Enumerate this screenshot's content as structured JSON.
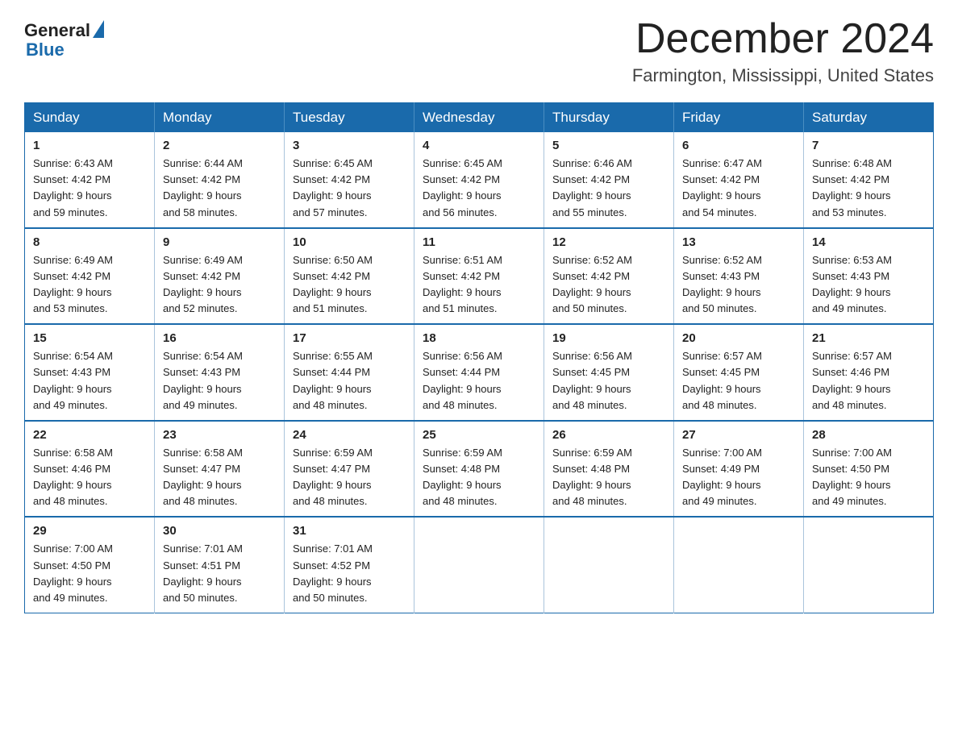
{
  "logo": {
    "general": "General",
    "blue": "Blue"
  },
  "header": {
    "month": "December 2024",
    "location": "Farmington, Mississippi, United States"
  },
  "weekdays": [
    "Sunday",
    "Monday",
    "Tuesday",
    "Wednesday",
    "Thursday",
    "Friday",
    "Saturday"
  ],
  "weeks": [
    [
      {
        "day": 1,
        "info": "Sunrise: 6:43 AM\nSunset: 4:42 PM\nDaylight: 9 hours\nand 59 minutes."
      },
      {
        "day": 2,
        "info": "Sunrise: 6:44 AM\nSunset: 4:42 PM\nDaylight: 9 hours\nand 58 minutes."
      },
      {
        "day": 3,
        "info": "Sunrise: 6:45 AM\nSunset: 4:42 PM\nDaylight: 9 hours\nand 57 minutes."
      },
      {
        "day": 4,
        "info": "Sunrise: 6:45 AM\nSunset: 4:42 PM\nDaylight: 9 hours\nand 56 minutes."
      },
      {
        "day": 5,
        "info": "Sunrise: 6:46 AM\nSunset: 4:42 PM\nDaylight: 9 hours\nand 55 minutes."
      },
      {
        "day": 6,
        "info": "Sunrise: 6:47 AM\nSunset: 4:42 PM\nDaylight: 9 hours\nand 54 minutes."
      },
      {
        "day": 7,
        "info": "Sunrise: 6:48 AM\nSunset: 4:42 PM\nDaylight: 9 hours\nand 53 minutes."
      }
    ],
    [
      {
        "day": 8,
        "info": "Sunrise: 6:49 AM\nSunset: 4:42 PM\nDaylight: 9 hours\nand 53 minutes."
      },
      {
        "day": 9,
        "info": "Sunrise: 6:49 AM\nSunset: 4:42 PM\nDaylight: 9 hours\nand 52 minutes."
      },
      {
        "day": 10,
        "info": "Sunrise: 6:50 AM\nSunset: 4:42 PM\nDaylight: 9 hours\nand 51 minutes."
      },
      {
        "day": 11,
        "info": "Sunrise: 6:51 AM\nSunset: 4:42 PM\nDaylight: 9 hours\nand 51 minutes."
      },
      {
        "day": 12,
        "info": "Sunrise: 6:52 AM\nSunset: 4:42 PM\nDaylight: 9 hours\nand 50 minutes."
      },
      {
        "day": 13,
        "info": "Sunrise: 6:52 AM\nSunset: 4:43 PM\nDaylight: 9 hours\nand 50 minutes."
      },
      {
        "day": 14,
        "info": "Sunrise: 6:53 AM\nSunset: 4:43 PM\nDaylight: 9 hours\nand 49 minutes."
      }
    ],
    [
      {
        "day": 15,
        "info": "Sunrise: 6:54 AM\nSunset: 4:43 PM\nDaylight: 9 hours\nand 49 minutes."
      },
      {
        "day": 16,
        "info": "Sunrise: 6:54 AM\nSunset: 4:43 PM\nDaylight: 9 hours\nand 49 minutes."
      },
      {
        "day": 17,
        "info": "Sunrise: 6:55 AM\nSunset: 4:44 PM\nDaylight: 9 hours\nand 48 minutes."
      },
      {
        "day": 18,
        "info": "Sunrise: 6:56 AM\nSunset: 4:44 PM\nDaylight: 9 hours\nand 48 minutes."
      },
      {
        "day": 19,
        "info": "Sunrise: 6:56 AM\nSunset: 4:45 PM\nDaylight: 9 hours\nand 48 minutes."
      },
      {
        "day": 20,
        "info": "Sunrise: 6:57 AM\nSunset: 4:45 PM\nDaylight: 9 hours\nand 48 minutes."
      },
      {
        "day": 21,
        "info": "Sunrise: 6:57 AM\nSunset: 4:46 PM\nDaylight: 9 hours\nand 48 minutes."
      }
    ],
    [
      {
        "day": 22,
        "info": "Sunrise: 6:58 AM\nSunset: 4:46 PM\nDaylight: 9 hours\nand 48 minutes."
      },
      {
        "day": 23,
        "info": "Sunrise: 6:58 AM\nSunset: 4:47 PM\nDaylight: 9 hours\nand 48 minutes."
      },
      {
        "day": 24,
        "info": "Sunrise: 6:59 AM\nSunset: 4:47 PM\nDaylight: 9 hours\nand 48 minutes."
      },
      {
        "day": 25,
        "info": "Sunrise: 6:59 AM\nSunset: 4:48 PM\nDaylight: 9 hours\nand 48 minutes."
      },
      {
        "day": 26,
        "info": "Sunrise: 6:59 AM\nSunset: 4:48 PM\nDaylight: 9 hours\nand 48 minutes."
      },
      {
        "day": 27,
        "info": "Sunrise: 7:00 AM\nSunset: 4:49 PM\nDaylight: 9 hours\nand 49 minutes."
      },
      {
        "day": 28,
        "info": "Sunrise: 7:00 AM\nSunset: 4:50 PM\nDaylight: 9 hours\nand 49 minutes."
      }
    ],
    [
      {
        "day": 29,
        "info": "Sunrise: 7:00 AM\nSunset: 4:50 PM\nDaylight: 9 hours\nand 49 minutes."
      },
      {
        "day": 30,
        "info": "Sunrise: 7:01 AM\nSunset: 4:51 PM\nDaylight: 9 hours\nand 50 minutes."
      },
      {
        "day": 31,
        "info": "Sunrise: 7:01 AM\nSunset: 4:52 PM\nDaylight: 9 hours\nand 50 minutes."
      },
      null,
      null,
      null,
      null
    ]
  ]
}
